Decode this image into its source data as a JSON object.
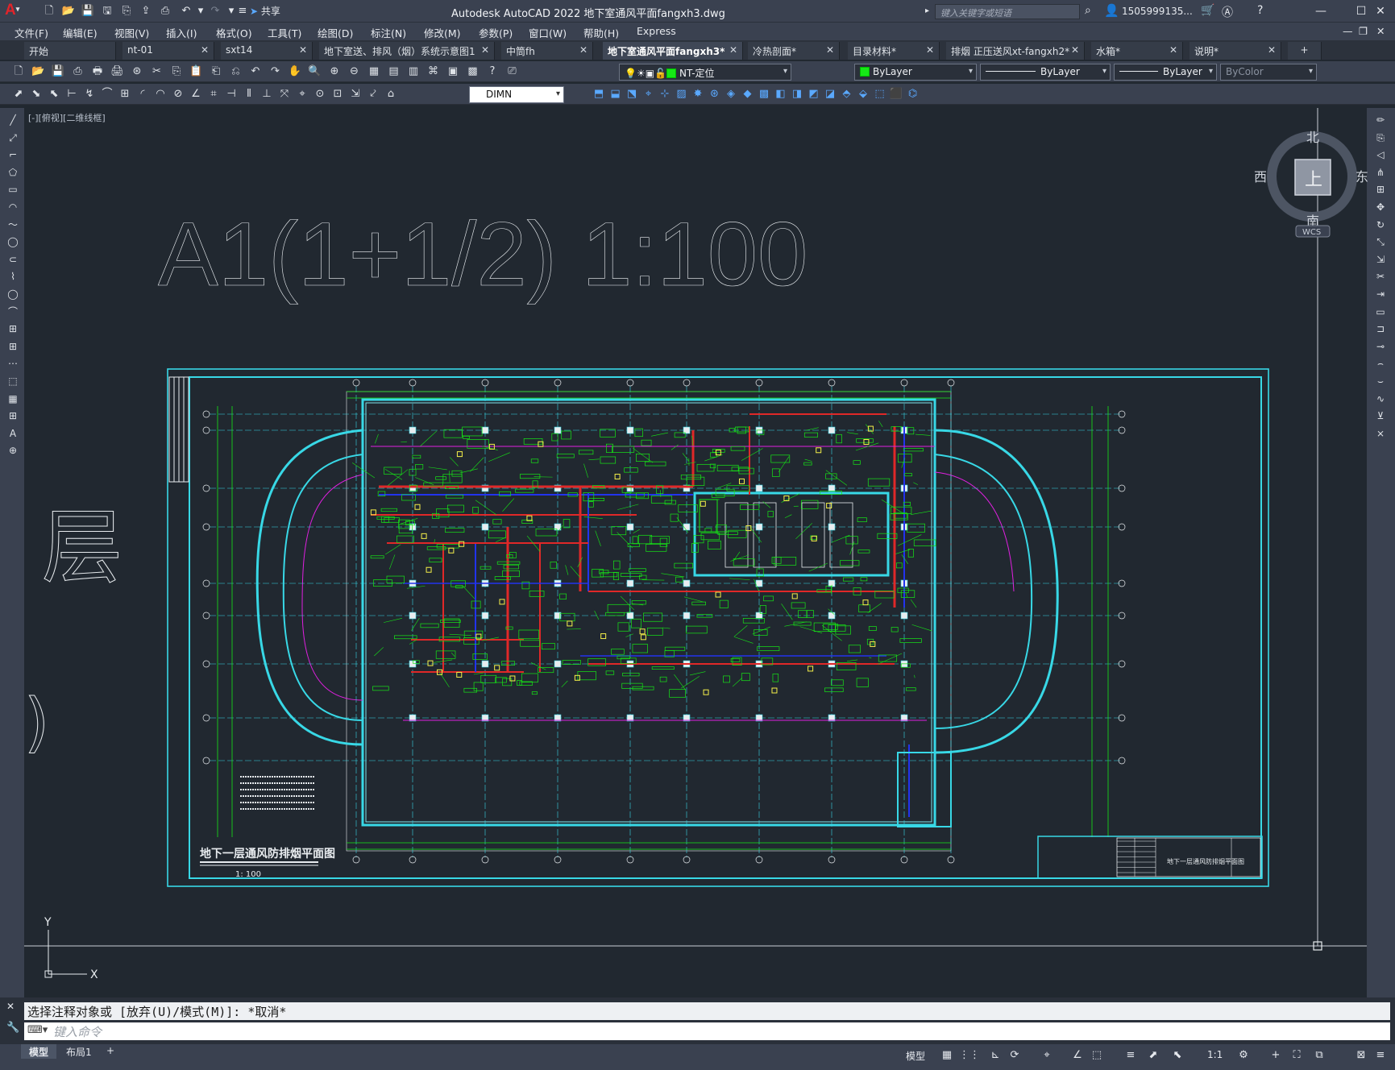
{
  "app": {
    "title": "Autodesk AutoCAD 2022    地下室通风平面fangxh3.dwg",
    "logo": "A",
    "share_label": "共享",
    "search_placeholder": "键入关键字或短语",
    "user_name": "1505999135...",
    "icons": [
      "new-icon",
      "open-icon",
      "save-icon",
      "saveas-icon",
      "open-web-icon",
      "save-web-icon",
      "plot-icon",
      "undo-icon",
      "redo-icon",
      "search-icon",
      "user-icon",
      "cart-icon",
      "autodesk-app-icon",
      "help-icon"
    ]
  },
  "window_controls": {
    "min": "—",
    "max": "☐",
    "close": "✕"
  },
  "menus": [
    "文件(F)",
    "编辑(E)",
    "视图(V)",
    "插入(I)",
    "格式(O)",
    "工具(T)",
    "绘图(D)",
    "标注(N)",
    "修改(M)",
    "参数(P)",
    "窗口(W)",
    "帮助(H)",
    "Express"
  ],
  "tabs": [
    {
      "label": "开始",
      "active": false
    },
    {
      "label": "nt-01",
      "active": false
    },
    {
      "label": "sxt14",
      "active": false
    },
    {
      "label": "地下室送、排风（烟）系统示意图1",
      "active": false
    },
    {
      "label": "中筒fh",
      "active": false
    },
    {
      "label": "地下室通风平面fangxh3*",
      "active": true
    },
    {
      "label": "冷热剖面*",
      "active": false
    },
    {
      "label": "目录材料*",
      "active": false
    },
    {
      "label": "排烟 正压送风xt-fangxh2*",
      "active": false
    },
    {
      "label": "水箱*",
      "active": false
    },
    {
      "label": "说明*",
      "active": false
    }
  ],
  "tab_add": "+",
  "toolbar": {
    "layer_name": "NT-定位",
    "color_combo": "ByLayer",
    "linetype_combo": "ByLayer",
    "lineweight_combo": "ByLayer",
    "plotstyle_combo": "ByColor",
    "dimstyle_combo": "DIMN",
    "layer_color": "#16e816"
  },
  "viewport": {
    "label": "[-][俯视][二维线框]",
    "big_text": "A1(1+1/2) 1:100",
    "side_char": "层",
    "side_char2": ")"
  },
  "drawing": {
    "title": "地下一层通风防排烟平面图",
    "scale": "1: 100",
    "titleblock_text": "地下一层通风防排烟平面图"
  },
  "viewcube": {
    "north": "北",
    "south": "南",
    "east": "东",
    "west": "西",
    "face": "上",
    "wcs": "WCS"
  },
  "ucs": {
    "x": "X",
    "y": "Y"
  },
  "command": {
    "history": "选择注释对象或 [放弃(U)/模式(M)]: *取消*",
    "placeholder": "键入命令"
  },
  "status": {
    "model_label": "模型",
    "layout_tab": "布局1",
    "add": "+",
    "model_space": "模型",
    "scale": "1:1"
  },
  "colors": {
    "cyan": "#38d8e6",
    "green": "#16e816",
    "red": "#e02828",
    "magenta": "#e020e0",
    "blue": "#2233ee",
    "yellow": "#f5f04a",
    "white": "#e8ecef"
  }
}
